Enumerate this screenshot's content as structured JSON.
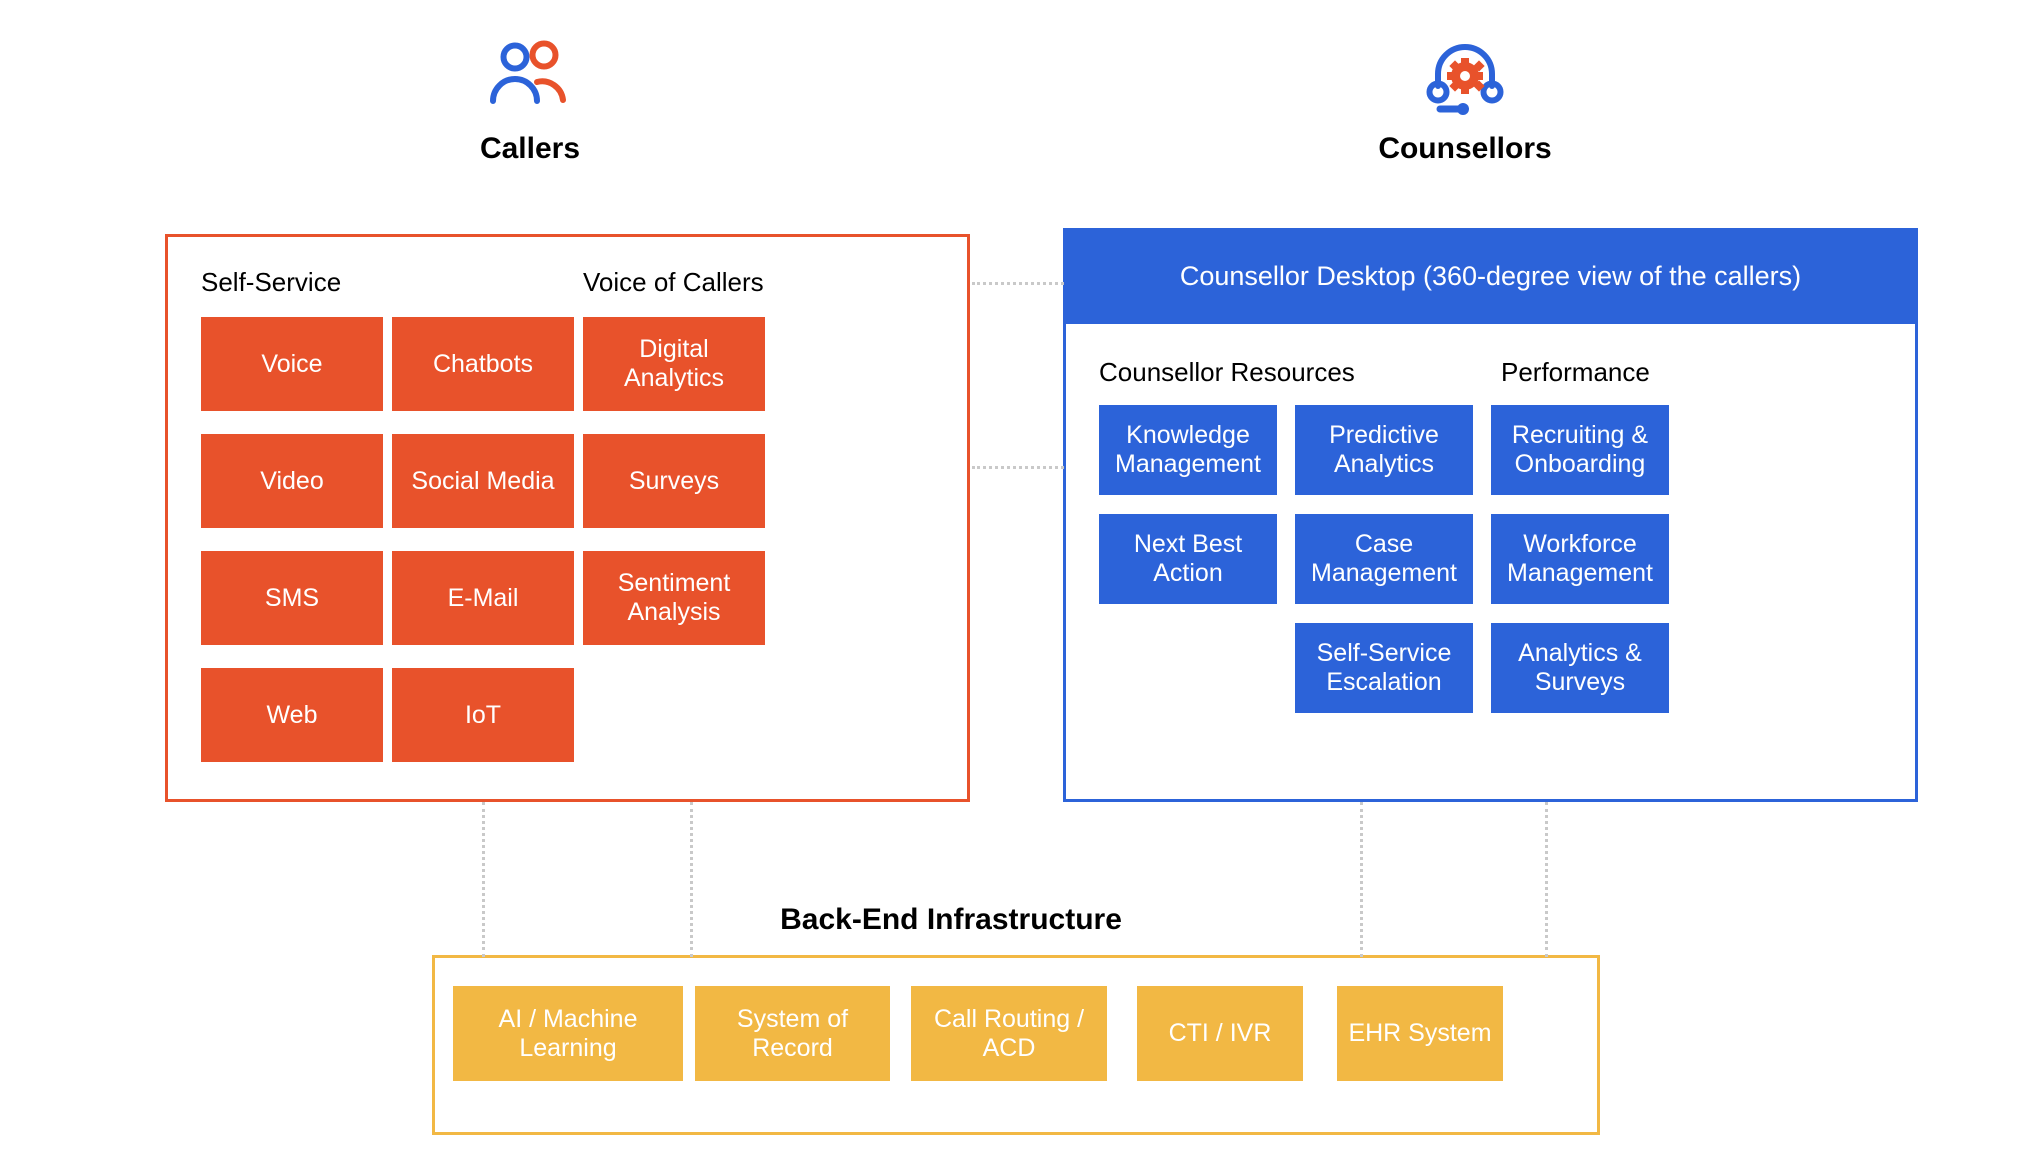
{
  "headers": {
    "callers": {
      "title": "Callers",
      "icon": "two-people-icon"
    },
    "counsellors": {
      "title": "Counsellors",
      "icon": "headset-gear-icon"
    }
  },
  "callers_panel": {
    "border_color": "#E8522B",
    "tile_color": "#E8522B",
    "groups": [
      {
        "label": "Self-Service"
      },
      {
        "label": "Voice of Callers"
      }
    ],
    "self_service_tiles": [
      "Voice",
      "Chatbots",
      "Video",
      "Social Media",
      "SMS",
      "E-Mail",
      "Web",
      "IoT"
    ],
    "voice_of_callers_tiles": [
      "Digital Analytics",
      "Surveys",
      "Sentiment Analysis"
    ]
  },
  "counsellors_panel": {
    "border_color": "#2C63D9",
    "tile_color": "#2C63D9",
    "banner": "Counsellor Desktop (360-degree view of the callers)",
    "groups": [
      {
        "label": "Counsellor Resources"
      },
      {
        "label": "Performance"
      }
    ],
    "resources_tiles": [
      "Knowledge Management",
      "Next Best Action",
      "Predictive Analytics",
      "Case Management",
      "Self-Service Escalation"
    ],
    "performance_tiles": [
      "Recruiting & Onboarding",
      "Workforce Management",
      "Analytics & Surveys"
    ]
  },
  "backend_panel": {
    "title": "Back-End Infrastructure",
    "border_color": "#F2B844",
    "tile_color": "#F2B844",
    "tiles": [
      "AI / Machine Learning",
      "System of Record",
      "Call Routing / ACD",
      "CTI / IVR",
      "EHR System"
    ]
  },
  "connectors": {
    "style": "dotted",
    "color": "#c9c9c9"
  }
}
